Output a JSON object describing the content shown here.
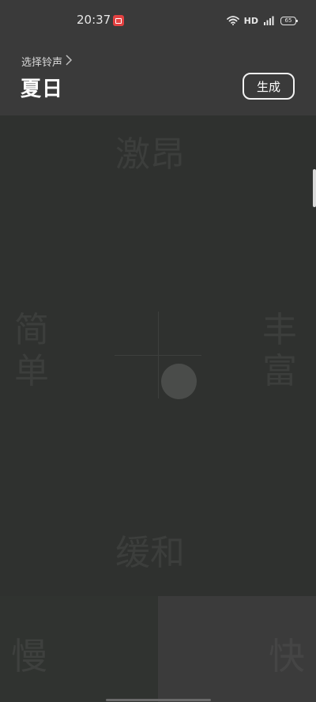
{
  "status_bar": {
    "time": "20:37",
    "network_label": "HD",
    "battery_level": "65",
    "icons": [
      "video-app-icon",
      "wifi-icon",
      "signal-icon",
      "battery-icon"
    ]
  },
  "header": {
    "breadcrumb": "选择铃声",
    "title": "夏日",
    "generate_label": "生成"
  },
  "mood_pad": {
    "top_label": "激昂",
    "bottom_label": "缓和",
    "left_label": "简单",
    "right_label": "丰富"
  },
  "tempo": {
    "slow_label": "慢",
    "fast_label": "快"
  },
  "colors": {
    "background": "#2f312f",
    "header_bg": "#3a3a3a",
    "status_app_icon": "#e34141",
    "label_dim": "#3c3e3c",
    "text_primary": "#ffffff"
  }
}
